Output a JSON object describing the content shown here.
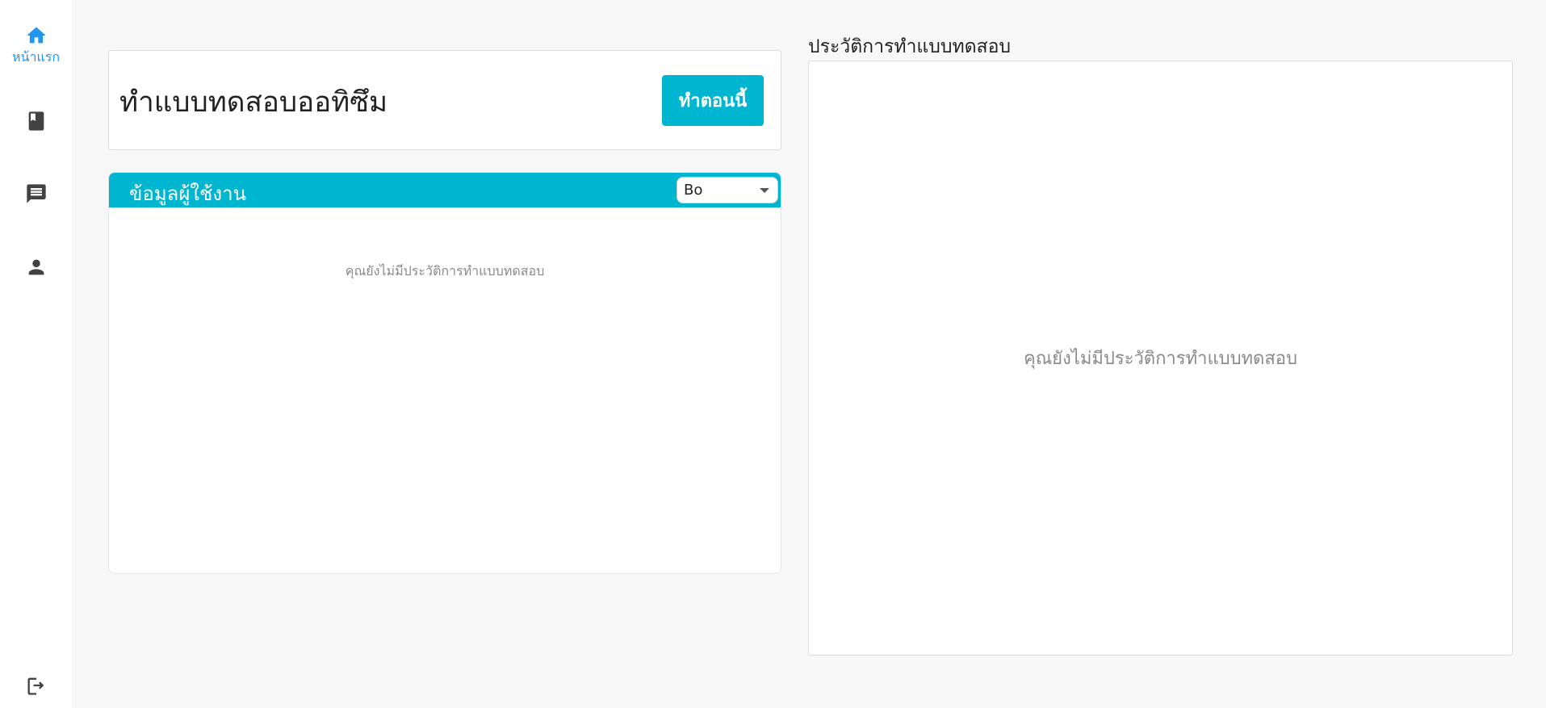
{
  "sidebar": {
    "items": [
      {
        "label": "หน้าแรก",
        "icon": "home-icon",
        "active": true
      },
      {
        "label": "",
        "icon": "book-icon",
        "active": false
      },
      {
        "label": "",
        "icon": "chat-icon",
        "active": false
      },
      {
        "label": "",
        "icon": "person-icon",
        "active": false
      }
    ],
    "logout_icon": "logout-icon"
  },
  "main": {
    "title": "ทำแบบทดสอบออทิซึม",
    "start_button": "ทำตอนนี้"
  },
  "user_panel": {
    "title": "ข้อมูลผู้ใช้งาน",
    "selected_user": "Bo",
    "empty_message": "คุณยังไม่มีประวัติการทำแบบทดสอบ"
  },
  "history": {
    "title": "ประวัติการทำแบบทดสอบ",
    "empty_message": "คุณยังไม่มีประวัติการทำแบบทดสอบ"
  },
  "colors": {
    "accent": "#00b5cf",
    "nav_active": "#2196f3",
    "nav_icon": "#424242"
  }
}
